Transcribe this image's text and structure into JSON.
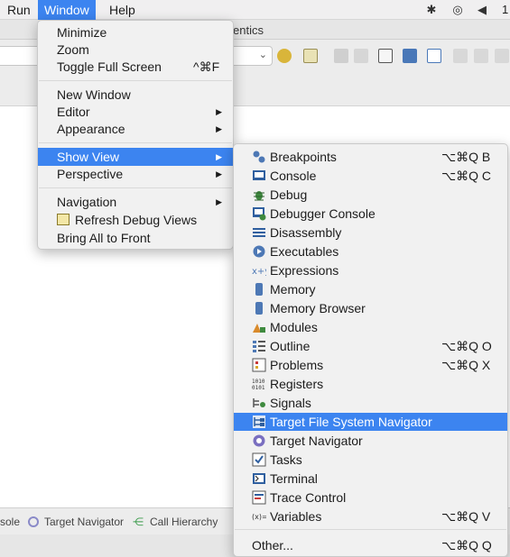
{
  "menubar": {
    "items": [
      "Run",
      "Window",
      "Help"
    ],
    "clock_partial": "1"
  },
  "background": {
    "tab_label_partial": "entics",
    "bottom_tabs": [
      "sole",
      "Target Navigator",
      "Call Hierarchy"
    ]
  },
  "window_menu": {
    "groups": [
      [
        {
          "label": "Minimize"
        },
        {
          "label": "Zoom"
        },
        {
          "label": "Toggle Full Screen",
          "shortcut": "^⌘F"
        }
      ],
      [
        {
          "label": "New Window"
        },
        {
          "label": "Editor",
          "submenu": true
        },
        {
          "label": "Appearance",
          "submenu": true
        }
      ],
      [
        {
          "label": "Show View",
          "submenu": true,
          "highlighted": true
        },
        {
          "label": "Perspective",
          "submenu": true
        }
      ],
      [
        {
          "label": "Navigation",
          "submenu": true
        },
        {
          "label": "Refresh Debug Views",
          "icon": "refresh-icon"
        },
        {
          "label": "Bring All to Front"
        }
      ]
    ]
  },
  "show_view_menu": {
    "items": [
      {
        "label": "Breakpoints",
        "shortcut": "⌥⌘Q B",
        "icon": "breakpoints-icon"
      },
      {
        "label": "Console",
        "shortcut": "⌥⌘Q C",
        "icon": "console-icon"
      },
      {
        "label": "Debug",
        "icon": "debug-icon"
      },
      {
        "label": "Debugger Console",
        "icon": "debugger-console-icon"
      },
      {
        "label": "Disassembly",
        "icon": "disassembly-icon"
      },
      {
        "label": "Executables",
        "icon": "executables-icon"
      },
      {
        "label": "Expressions",
        "icon": "expressions-icon"
      },
      {
        "label": "Memory",
        "icon": "memory-icon"
      },
      {
        "label": "Memory Browser",
        "icon": "memory-browser-icon"
      },
      {
        "label": "Modules",
        "icon": "modules-icon"
      },
      {
        "label": "Outline",
        "shortcut": "⌥⌘Q O",
        "icon": "outline-icon"
      },
      {
        "label": "Problems",
        "shortcut": "⌥⌘Q X",
        "icon": "problems-icon"
      },
      {
        "label": "Registers",
        "icon": "registers-icon"
      },
      {
        "label": "Signals",
        "icon": "signals-icon"
      },
      {
        "label": "Target File System Navigator",
        "icon": "target-fs-navigator-icon",
        "highlighted": true
      },
      {
        "label": "Target Navigator",
        "icon": "target-navigator-icon"
      },
      {
        "label": "Tasks",
        "icon": "tasks-icon"
      },
      {
        "label": "Terminal",
        "icon": "terminal-icon"
      },
      {
        "label": "Trace Control",
        "icon": "trace-control-icon"
      },
      {
        "label": "Variables",
        "shortcut": "⌥⌘Q V",
        "icon": "variables-icon"
      }
    ],
    "other": {
      "label": "Other...",
      "shortcut": "⌥⌘Q Q"
    }
  },
  "colors": {
    "highlight": "#3c84f0",
    "menu_bg": "#f1f1f1",
    "menubar_bg": "#f0eff0"
  }
}
